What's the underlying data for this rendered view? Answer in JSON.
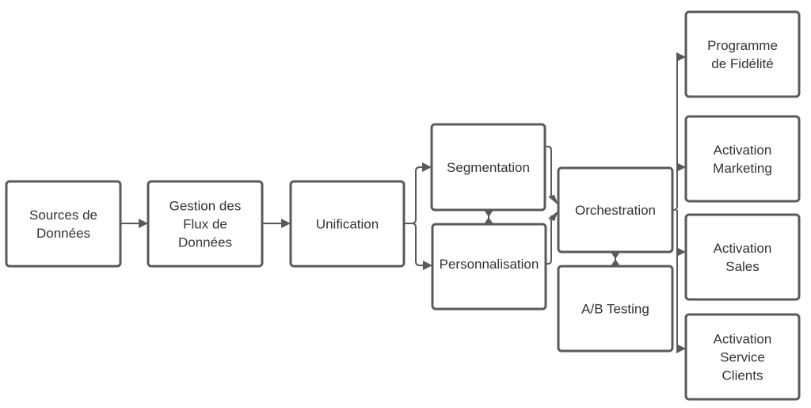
{
  "diagram": {
    "colors": {
      "stroke": "#5a5a5a",
      "text": "#333333",
      "background": "#ffffff"
    },
    "nodes": [
      {
        "id": "sources",
        "lines": [
          "Sources de",
          "Données"
        ]
      },
      {
        "id": "gestion",
        "lines": [
          "Gestion des",
          "Flux de",
          "Données"
        ]
      },
      {
        "id": "unification",
        "lines": [
          "Unification"
        ]
      },
      {
        "id": "segmentation",
        "lines": [
          "Segmentation"
        ]
      },
      {
        "id": "personnalisation",
        "lines": [
          "Personnalisation"
        ]
      },
      {
        "id": "orchestration",
        "lines": [
          "Orchestration"
        ]
      },
      {
        "id": "abtesting",
        "lines": [
          "A/B Testing"
        ]
      },
      {
        "id": "fidelite",
        "lines": [
          "Programme",
          "de Fidélité"
        ]
      },
      {
        "id": "marketing",
        "lines": [
          "Activation",
          "Marketing"
        ]
      },
      {
        "id": "sales",
        "lines": [
          "Activation",
          "Sales"
        ]
      },
      {
        "id": "service",
        "lines": [
          "Activation",
          "Service",
          "Clients"
        ]
      }
    ],
    "edges": [
      {
        "from": "sources",
        "to": "gestion",
        "type": "arrow"
      },
      {
        "from": "gestion",
        "to": "unification",
        "type": "arrow"
      },
      {
        "from": "unification",
        "to": "segmentation",
        "type": "arrow"
      },
      {
        "from": "unification",
        "to": "personnalisation",
        "type": "arrow"
      },
      {
        "from": "segmentation",
        "to": "personnalisation",
        "type": "bidirectional"
      },
      {
        "from": "segmentation",
        "to": "orchestration",
        "type": "arrow"
      },
      {
        "from": "personnalisation",
        "to": "orchestration",
        "type": "arrow"
      },
      {
        "from": "orchestration",
        "to": "abtesting",
        "type": "bidirectional"
      },
      {
        "from": "orchestration",
        "to": "fidelite",
        "type": "arrow"
      },
      {
        "from": "orchestration",
        "to": "marketing",
        "type": "arrow"
      },
      {
        "from": "orchestration",
        "to": "sales",
        "type": "arrow"
      },
      {
        "from": "orchestration",
        "to": "service",
        "type": "arrow"
      }
    ]
  }
}
